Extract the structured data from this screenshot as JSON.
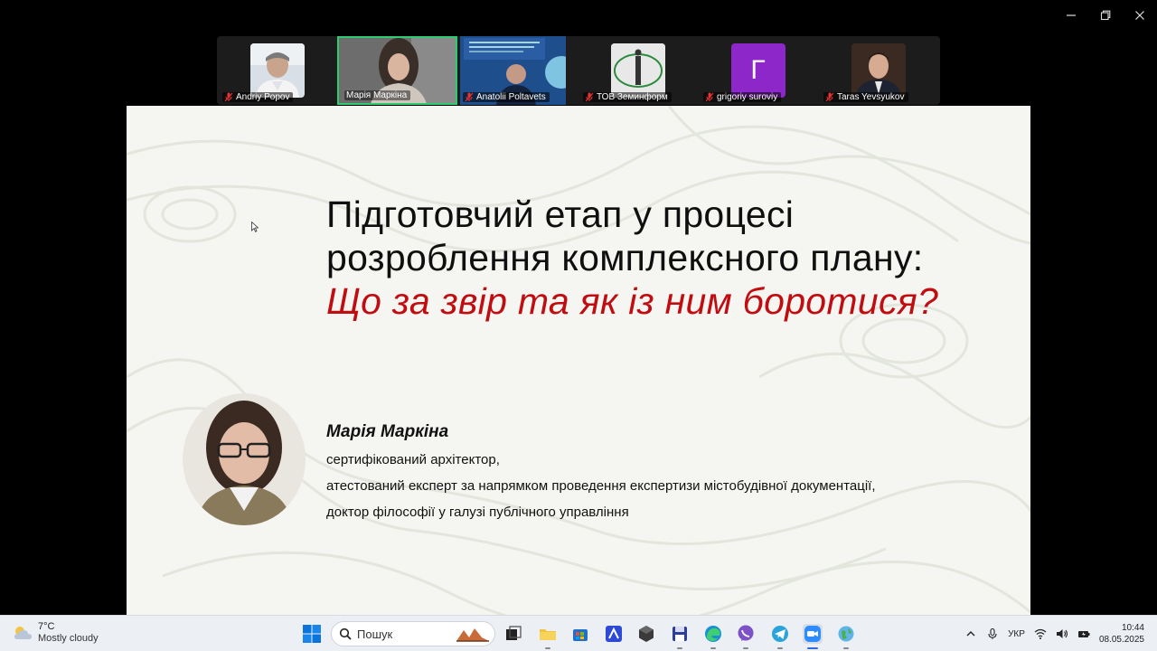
{
  "participants": [
    {
      "name": "Andriy Popov",
      "muted": true,
      "avatar_color": "#cfd6de"
    },
    {
      "name": "Марія Маркіна",
      "muted": false,
      "active": true
    },
    {
      "name": "Anatolii Poltavets",
      "muted": true
    },
    {
      "name": "ТОВ Земинформ",
      "muted": true
    },
    {
      "name": "grigoriy suroviy",
      "muted": true,
      "letter": "Г",
      "avatar_color": "#8e27c9"
    },
    {
      "name": "Taras Yevsyukov",
      "muted": true
    }
  ],
  "slide": {
    "title_line1": "Підготовчий етап у процесі",
    "title_line2": "розроблення комплексного плану:",
    "subtitle": "Що за звір та як із ним боротися?",
    "speaker_name": "Марія Маркіна",
    "speaker_lines": [
      "сертифікований  архітектор,",
      "атестований  експерт  за  напрямком  проведення   експертизи  містобудівної  документації,",
      "доктор  філософії  у  галузі  публічного  управління"
    ],
    "accent_color": "#c00d12"
  },
  "taskbar": {
    "weather_temp": "7°C",
    "weather_condition": "Mostly cloudy",
    "search_placeholder": "Пошук",
    "language": "УКР",
    "time": "10:44",
    "date": "08.05.2025"
  }
}
